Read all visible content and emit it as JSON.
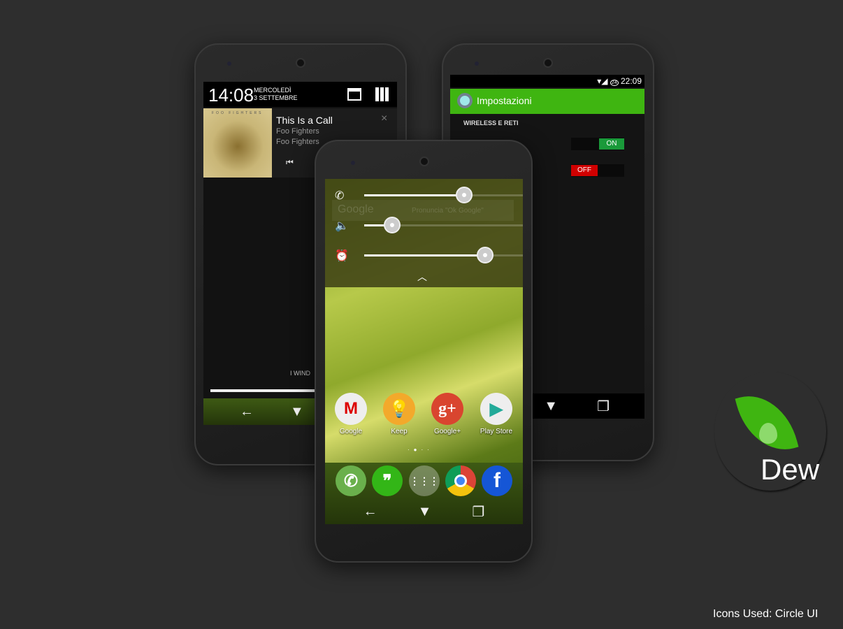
{
  "left_phone": {
    "clock": "14:08",
    "day": "MERCOLEDÌ",
    "date": "3 SETTEMBRE",
    "album_label": "FOO FIGHTERS",
    "track_title": "This Is a Call",
    "artist": "Foo Fighters",
    "album": "Foo Fighters",
    "lower_text": "I WIND",
    "icons": [
      "window-icon",
      "user-grid-icon",
      "close-icon",
      "previous-track-icon",
      "back-icon",
      "home-icon"
    ]
  },
  "right_phone": {
    "status_time": "22:09",
    "status_badge": "24",
    "title": "Impostazioni",
    "section": "WIRELESS E RETI",
    "toggles": [
      {
        "label": "ON",
        "state": true,
        "color": "#1a9a3a"
      },
      {
        "label": "OFF",
        "state": false,
        "color": "#d00000"
      }
    ],
    "accent": "#3fb511"
  },
  "center_phone": {
    "search_ghost": "Google",
    "search_hint": "Pronuncia \"Ok Google\"",
    "volume": [
      {
        "icon": "phone-icon",
        "level": 0.57
      },
      {
        "icon": "speaker-icon",
        "level": 0.16
      },
      {
        "icon": "alarm-icon",
        "level": 0.69
      }
    ],
    "apps": [
      {
        "label": "Google",
        "color": "#eeeeee"
      },
      {
        "label": "Keep",
        "color": "#f3a92b"
      },
      {
        "label": "Google+",
        "color": "#d9452f"
      },
      {
        "label": "Play Store",
        "color": "#eeeeee"
      }
    ],
    "dock": [
      {
        "name": "phone",
        "color": "#6ab04c"
      },
      {
        "name": "hangouts",
        "color": "#33b617"
      },
      {
        "name": "app-drawer",
        "color": "rgba(255,255,255,0.3)"
      },
      {
        "name": "chrome",
        "color": "#eeeeee"
      },
      {
        "name": "facebook",
        "color": "#1556d6"
      }
    ],
    "page_dots": 4,
    "active_page": 1
  },
  "brand": {
    "name": "Dew",
    "credit": "Icons Used: Circle UI",
    "leaf_color": "#3fb511"
  }
}
